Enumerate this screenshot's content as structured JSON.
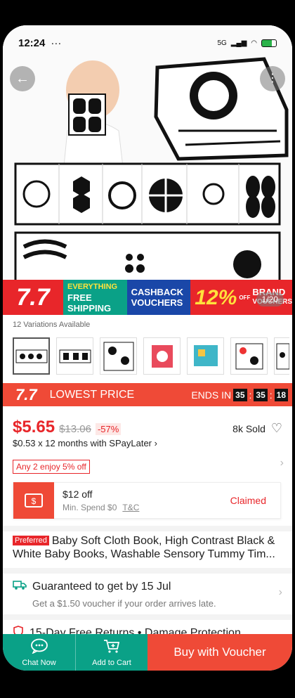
{
  "status": {
    "time": "12:24",
    "signal": "5G",
    "dots": "···"
  },
  "hero": {
    "counter": "1/20"
  },
  "banner": {
    "sale_tag": "7.7",
    "shipping_line1": "EVERYTHING",
    "shipping_line2": "FREE",
    "shipping_line3": "SHIPPING",
    "cashback_line1": "CASHBACK",
    "cashback_line2": "VOUCHERS",
    "brand_pct": "12%",
    "brand_off": "OFF",
    "brand_line1": "BRAND",
    "brand_line2": "VOUCHERS"
  },
  "variations": {
    "label": "12 Variations Available"
  },
  "price_bar": {
    "tag": "7.7",
    "label": "LOWEST PRICE",
    "ends_label": "ENDS IN",
    "h": "35",
    "m": "35",
    "s": "18"
  },
  "price": {
    "current": "$5.65",
    "original": "$13.06",
    "discount": "-57%",
    "sold": "8k Sold",
    "installment": "$0.53 x 12 months with SPayLater ›"
  },
  "promo": {
    "label": "Any 2 enjoy 5% off"
  },
  "coupon": {
    "title": "$12 off",
    "min": "Min. Spend $0",
    "tc": "T&C",
    "status": "Claimed"
  },
  "product": {
    "badge": "Preferred",
    "title": "Baby Soft Cloth Book, High Contrast Black & White Baby Books, Washable Sensory Tummy Tim..."
  },
  "delivery": {
    "title": "Guaranteed to get by 15 Jul",
    "subtitle": "Get a $1.50 voucher if your order arrives late."
  },
  "returns": {
    "text": "15-Day Free Returns  •  Damage Protection"
  },
  "bottom": {
    "chat": "Chat Now",
    "cart": "Add to Cart",
    "buy": "Buy with Voucher"
  },
  "colors": {
    "accent": "#ef4a37",
    "green": "#0aa187",
    "blue": "#1a47a8"
  }
}
